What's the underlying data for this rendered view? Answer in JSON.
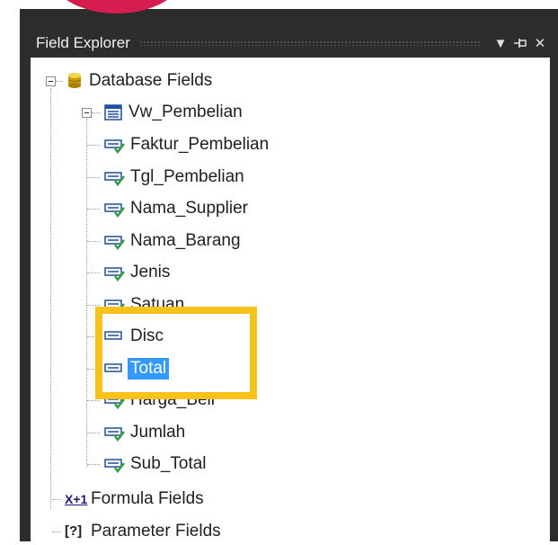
{
  "panel": {
    "title": "Field Explorer",
    "buttons": [
      {
        "name": "dropdown-arrow-icon",
        "glyph": "▼"
      },
      {
        "name": "pin-icon",
        "glyph": ""
      },
      {
        "name": "close-icon",
        "glyph": "✕"
      }
    ]
  },
  "tree": {
    "database_fields": "Database Fields",
    "view_name": "Vw_Pembelian",
    "fields": [
      {
        "label": "Faktur_Pembelian",
        "linked": true
      },
      {
        "label": "Tgl_Pembelian",
        "linked": true
      },
      {
        "label": "Nama_Supplier",
        "linked": true
      },
      {
        "label": "Nama_Barang",
        "linked": true
      },
      {
        "label": "Jenis",
        "linked": true
      },
      {
        "label": "Satuan",
        "linked": true
      },
      {
        "label": "Disc",
        "linked": false
      },
      {
        "label": "Total",
        "linked": false,
        "selected": true
      },
      {
        "label": "Harga_Beli",
        "linked": true
      },
      {
        "label": "Jumlah",
        "linked": true
      },
      {
        "label": "Sub_Total",
        "linked": true
      }
    ],
    "formula_fields": "Formula Fields",
    "formula_icon": "X+1",
    "parameter_fields": "Parameter Fields",
    "parameter_icon": "[?]"
  },
  "colors": {
    "highlight": "#f7c21a",
    "selection": "#3399ff",
    "check": "#2e9e3e",
    "accent_arc": "#d61d50"
  }
}
